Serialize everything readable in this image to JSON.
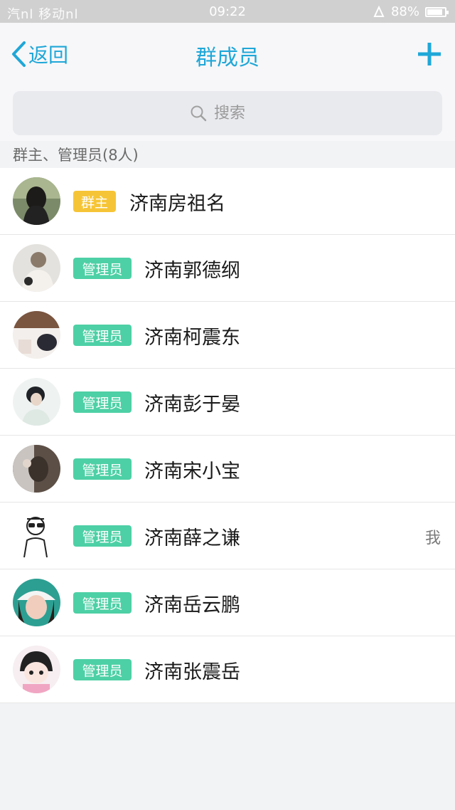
{
  "status_bar": {
    "carrier": "汽nl 移动nl",
    "time": "09:22",
    "battery_text": "88%",
    "battery_level": 0.88
  },
  "nav": {
    "back_label": "返回",
    "title": "群成员"
  },
  "search": {
    "placeholder": "搜索"
  },
  "section": {
    "title": "群主、管理员(8人)"
  },
  "members": [
    {
      "name": "济南房祖名",
      "role": "群主",
      "me": ""
    },
    {
      "name": "济南郭德纲",
      "role": "管理员",
      "me": ""
    },
    {
      "name": "济南柯震东",
      "role": "管理员",
      "me": ""
    },
    {
      "name": "济南彭于晏",
      "role": "管理员",
      "me": ""
    },
    {
      "name": "济南宋小宝",
      "role": "管理员",
      "me": ""
    },
    {
      "name": "济南薛之谦",
      "role": "管理员",
      "me": "我"
    },
    {
      "name": "济南岳云鹏",
      "role": "管理员",
      "me": ""
    },
    {
      "name": "济南张震岳",
      "role": "管理员",
      "me": ""
    }
  ],
  "colors": {
    "accent": "#1fa7d8",
    "owner_badge": "#f6c537",
    "admin_badge": "#4dd0a5"
  }
}
